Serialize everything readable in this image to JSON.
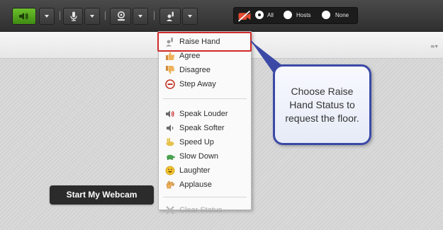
{
  "toolbar": {
    "audio_button": {
      "icon": "speaker-icon",
      "state": "active"
    },
    "mic_button": {
      "icon": "microphone-icon"
    },
    "camera_button": {
      "icon": "webcam-icon"
    },
    "status_button": {
      "icon": "raise-hand-icon"
    },
    "camera_group": {
      "icon": "camera-off-icon",
      "options": [
        {
          "label": "All",
          "checked": true
        },
        {
          "label": "Hosts",
          "checked": false
        },
        {
          "label": "None",
          "checked": false
        }
      ]
    }
  },
  "content": {
    "webcam_button_label": "Start My Webcam"
  },
  "status_menu": {
    "items": [
      {
        "label": "Raise Hand",
        "icon": "raise-hand-icon",
        "highlighted": true
      },
      {
        "label": "Agree",
        "icon": "thumbs-up-icon"
      },
      {
        "label": "Disagree",
        "icon": "thumbs-down-icon"
      },
      {
        "label": "Step Away",
        "icon": "step-away-icon"
      },
      {
        "label": "Speak Louder",
        "icon": "speaker-louder-icon"
      },
      {
        "label": "Speak Softer",
        "icon": "speaker-softer-icon"
      },
      {
        "label": "Speed Up",
        "icon": "rabbit-icon"
      },
      {
        "label": "Slow Down",
        "icon": "turtle-icon"
      },
      {
        "label": "Laughter",
        "icon": "smiley-icon"
      },
      {
        "label": "Applause",
        "icon": "applause-icon"
      },
      {
        "label": "Clear Status",
        "icon": "clear-icon",
        "disabled": true
      }
    ]
  },
  "callout": {
    "text": "Choose Raise Hand Status to request the floor."
  },
  "colors": {
    "toolbar_bg": "#3a3a3a",
    "audio_active": "#4f9e1c",
    "highlight_border": "#cf2a2a",
    "callout_border": "#3b49a6"
  }
}
